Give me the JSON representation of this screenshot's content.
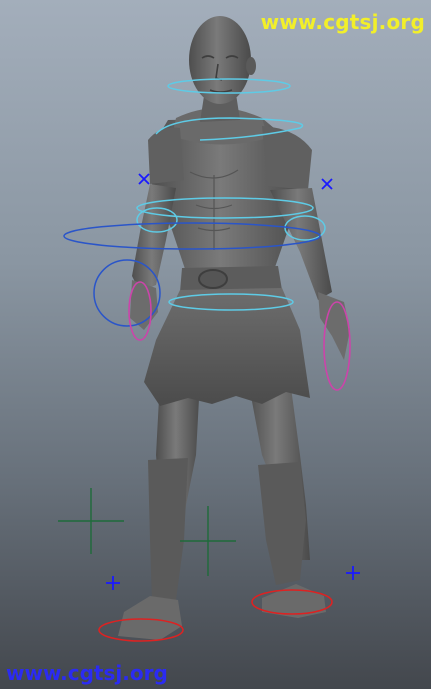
{
  "viewport": {
    "background_top": "#a3aebb",
    "background_bottom": "#43474d"
  },
  "watermarks": {
    "top_right": "www.cgtsj.org",
    "bottom_left": "www.cgtsj.org",
    "top_color": "#f2ef2a",
    "bottom_color": "#2b2bf2"
  },
  "rig_colors": {
    "fk_control": "#5ecbe6",
    "ik_control": "#2222dd",
    "hand_control": "#cc44aa",
    "foot_control": "#dd2222",
    "pole_marker": "#1e6b3a",
    "locator": "#1a1aff"
  },
  "model": {
    "surface_color": "#6b6b6b",
    "shade_color": "#4a4a4a"
  }
}
